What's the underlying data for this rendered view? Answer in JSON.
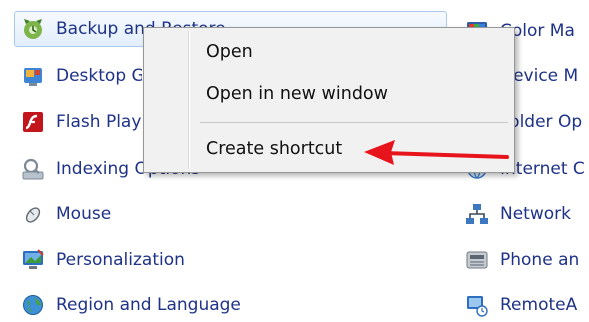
{
  "left_column": [
    {
      "label": "Backup and Restore",
      "icon": "backup-restore-icon"
    },
    {
      "label": "Desktop Gadgets",
      "icon": "desktop-gadgets-icon"
    },
    {
      "label": "Flash Player",
      "icon": "flash-player-icon"
    },
    {
      "label": "Indexing Options",
      "icon": "indexing-options-icon"
    },
    {
      "label": "Mouse",
      "icon": "mouse-icon"
    },
    {
      "label": "Personalization",
      "icon": "personalization-icon"
    },
    {
      "label": "Region and Language",
      "icon": "region-language-icon"
    }
  ],
  "right_column": [
    {
      "label": "Color Ma",
      "icon": "color-management-icon"
    },
    {
      "label": "Device M",
      "icon": "device-manager-icon"
    },
    {
      "label": "Folder Op",
      "icon": "folder-options-icon"
    },
    {
      "label": "Internet C",
      "icon": "internet-options-icon"
    },
    {
      "label": "Network",
      "icon": "network-icon"
    },
    {
      "label": "Phone an",
      "icon": "phone-modem-icon"
    },
    {
      "label": "RemoteA",
      "icon": "remoteapp-icon"
    }
  ],
  "context_menu": {
    "open": "Open",
    "open_new_window": "Open in new window",
    "create_shortcut": "Create shortcut"
  },
  "colors": {
    "link_text": "#1e3287",
    "arrow": "#e8141b",
    "hover_border": "#a9c9ea",
    "menu_background": "#f1f1f1"
  }
}
